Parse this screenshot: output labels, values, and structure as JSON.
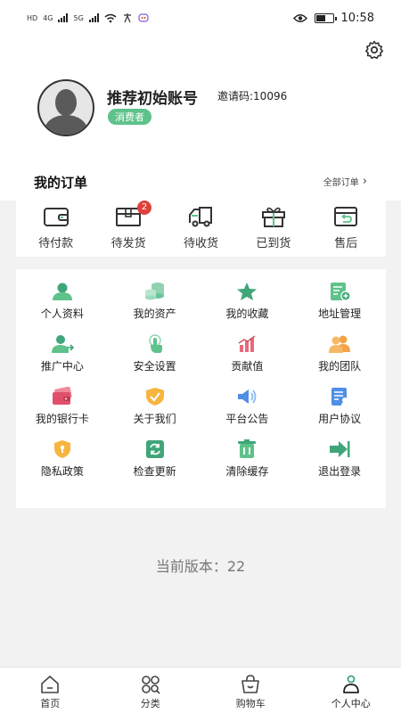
{
  "status_bar": {
    "left_labels": [
      "HD",
      "4G",
      "5G"
    ],
    "time": "10:58"
  },
  "profile": {
    "username": "推荐初始账号",
    "invite_code": "邀请码:10096",
    "role_badge": "消费者"
  },
  "orders": {
    "title": "我的订单",
    "view_all": "全部订单",
    "items": [
      {
        "label": "待付款",
        "icon": "wallet-icon"
      },
      {
        "label": "待发货",
        "icon": "box-icon",
        "badge": "2"
      },
      {
        "label": "待收货",
        "icon": "truck-icon"
      },
      {
        "label": "已到货",
        "icon": "gift-icon"
      },
      {
        "label": "售后",
        "icon": "return-box-icon"
      }
    ]
  },
  "menu": {
    "items": [
      {
        "label": "个人资料",
        "icon": "user-profile-icon"
      },
      {
        "label": "我的资产",
        "icon": "coins-icon"
      },
      {
        "label": "我的收藏",
        "icon": "star-icon"
      },
      {
        "label": "地址管理",
        "icon": "address-icon"
      },
      {
        "label": "推广中心",
        "icon": "promote-icon"
      },
      {
        "label": "安全设置",
        "icon": "touch-icon"
      },
      {
        "label": "贡献值",
        "icon": "bar-chart-icon"
      },
      {
        "label": "我的团队",
        "icon": "team-icon"
      },
      {
        "label": "我的银行卡",
        "icon": "bank-card-icon"
      },
      {
        "label": "关于我们",
        "icon": "shield-check-icon"
      },
      {
        "label": "平台公告",
        "icon": "speaker-icon"
      },
      {
        "label": "用户协议",
        "icon": "agreement-icon"
      },
      {
        "label": "隐私政策",
        "icon": "lock-shield-icon"
      },
      {
        "label": "检查更新",
        "icon": "refresh-icon"
      },
      {
        "label": "清除缓存",
        "icon": "trash-icon"
      },
      {
        "label": "退出登录",
        "icon": "logout-icon"
      }
    ]
  },
  "version_text": "当前版本：22",
  "bottom_nav": {
    "items": [
      {
        "label": "首页",
        "icon": "home-icon"
      },
      {
        "label": "分类",
        "icon": "category-icon"
      },
      {
        "label": "购物车",
        "icon": "cart-icon"
      },
      {
        "label": "个人中心",
        "icon": "person-icon",
        "active": true
      }
    ]
  },
  "colors": {
    "accent_green": "#5ec28a",
    "badge_red": "#e0403a",
    "background": "#f2f2f2"
  }
}
